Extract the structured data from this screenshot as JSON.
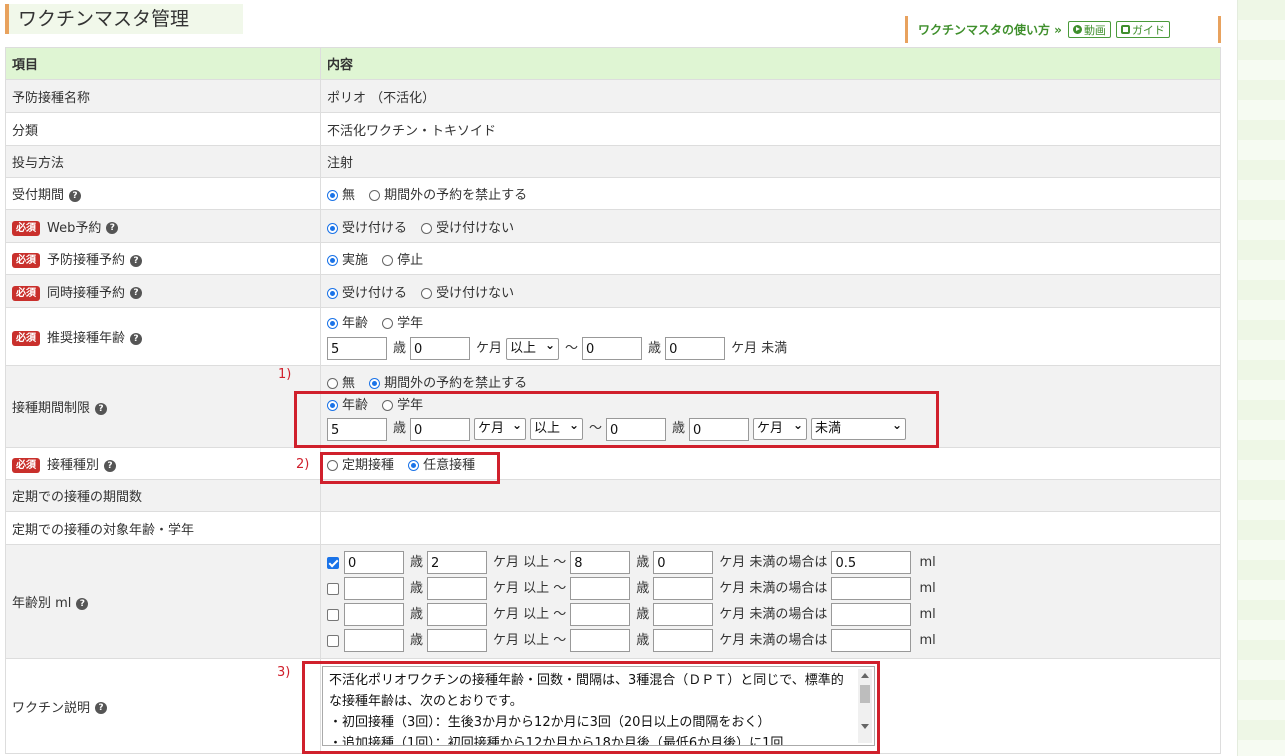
{
  "page": {
    "title": "ワクチンマスタ管理",
    "help_link": "ワクチンマスタの使い方 »",
    "video_btn": "動画",
    "guide_btn": "ガイド"
  },
  "table": {
    "header": {
      "item": "項目",
      "content": "内容"
    },
    "required_badge": "必須",
    "name": {
      "label": "予防接種名称",
      "value": "ポリオ （不活化）"
    },
    "category": {
      "label": "分類",
      "value": "不活化ワクチン・トキソイド"
    },
    "method": {
      "label": "投与方法",
      "value": "注射"
    },
    "reception": {
      "label": "受付期間",
      "opt1": "無",
      "opt2": "期間外の予約を禁止する",
      "selected": "無"
    },
    "web": {
      "label": "Web予約",
      "opt1": "受け付ける",
      "opt2": "受け付けない",
      "selected": "受け付ける"
    },
    "reservation": {
      "label": "予防接種予約",
      "opt1": "実施",
      "opt2": "停止",
      "selected": "実施"
    },
    "simultaneous": {
      "label": "同時接種予約",
      "opt1": "受け付ける",
      "opt2": "受け付けない",
      "selected": "受け付ける"
    },
    "recommended_age": {
      "label": "推奨接種年齢",
      "opt1": "年齢",
      "opt2": "学年",
      "selected": "年齢",
      "from_years": "5",
      "from_months": "0",
      "from_cond": "以上",
      "to_years": "0",
      "to_months": "0",
      "u_years": "歳",
      "u_months": "ケ月",
      "u_less": "未満",
      "tilde": "～"
    },
    "period_limit": {
      "label": "接種期間制限",
      "opt1": "無",
      "opt2": "期間外の予約を禁止する",
      "selected": "期間外の予約を禁止する",
      "age_opt1": "年齢",
      "age_opt2": "学年",
      "age_selected": "年齢",
      "from_years": "5",
      "from_months": "0",
      "from_unit": "ケ月",
      "from_cond": "以上",
      "to_years": "0",
      "to_months": "0",
      "to_unit": "ケ月",
      "to_cond": "未満"
    },
    "type": {
      "label": "接種種別",
      "opt1": "定期接種",
      "opt2": "任意接種",
      "selected": "任意接種"
    },
    "periodic_count": {
      "label": "定期での接種の期間数",
      "value": ""
    },
    "periodic_target": {
      "label": "定期での接種の対象年齢・学年",
      "value": ""
    },
    "age_ml": {
      "label": "年齢別 ml",
      "rows": [
        {
          "checked": true,
          "from_years": "0",
          "from_months": "2",
          "to_years": "8",
          "to_months": "0",
          "ml": "0.5"
        },
        {
          "checked": false,
          "from_years": "",
          "from_months": "",
          "to_years": "",
          "to_months": "",
          "ml": ""
        },
        {
          "checked": false,
          "from_years": "",
          "from_months": "",
          "to_years": "",
          "to_months": "",
          "ml": ""
        },
        {
          "checked": false,
          "from_years": "",
          "from_months": "",
          "to_years": "",
          "to_months": "",
          "ml": ""
        }
      ],
      "u_months_above": "ケ月 以上 ～",
      "u_months_case": "ケ月 未満の場合は",
      "u_ml": "ml"
    },
    "description": {
      "label": "ワクチン説明",
      "text": "不活化ポリオワクチンの接種年齢・回数・間隔は、3種混合（ＤＰＴ）と同じで、標準的な接種年齢は、次のとおりです。\n・初回接種（3回）：生後3か月から12か月に3回（20日以上の間隔をおく）\n・追加接種（1回）：初回接種から12か月から18か月後（最低6か月後）に1回"
    }
  },
  "annotations": {
    "a1": "1)",
    "a2": "2)",
    "a3": "3)"
  }
}
